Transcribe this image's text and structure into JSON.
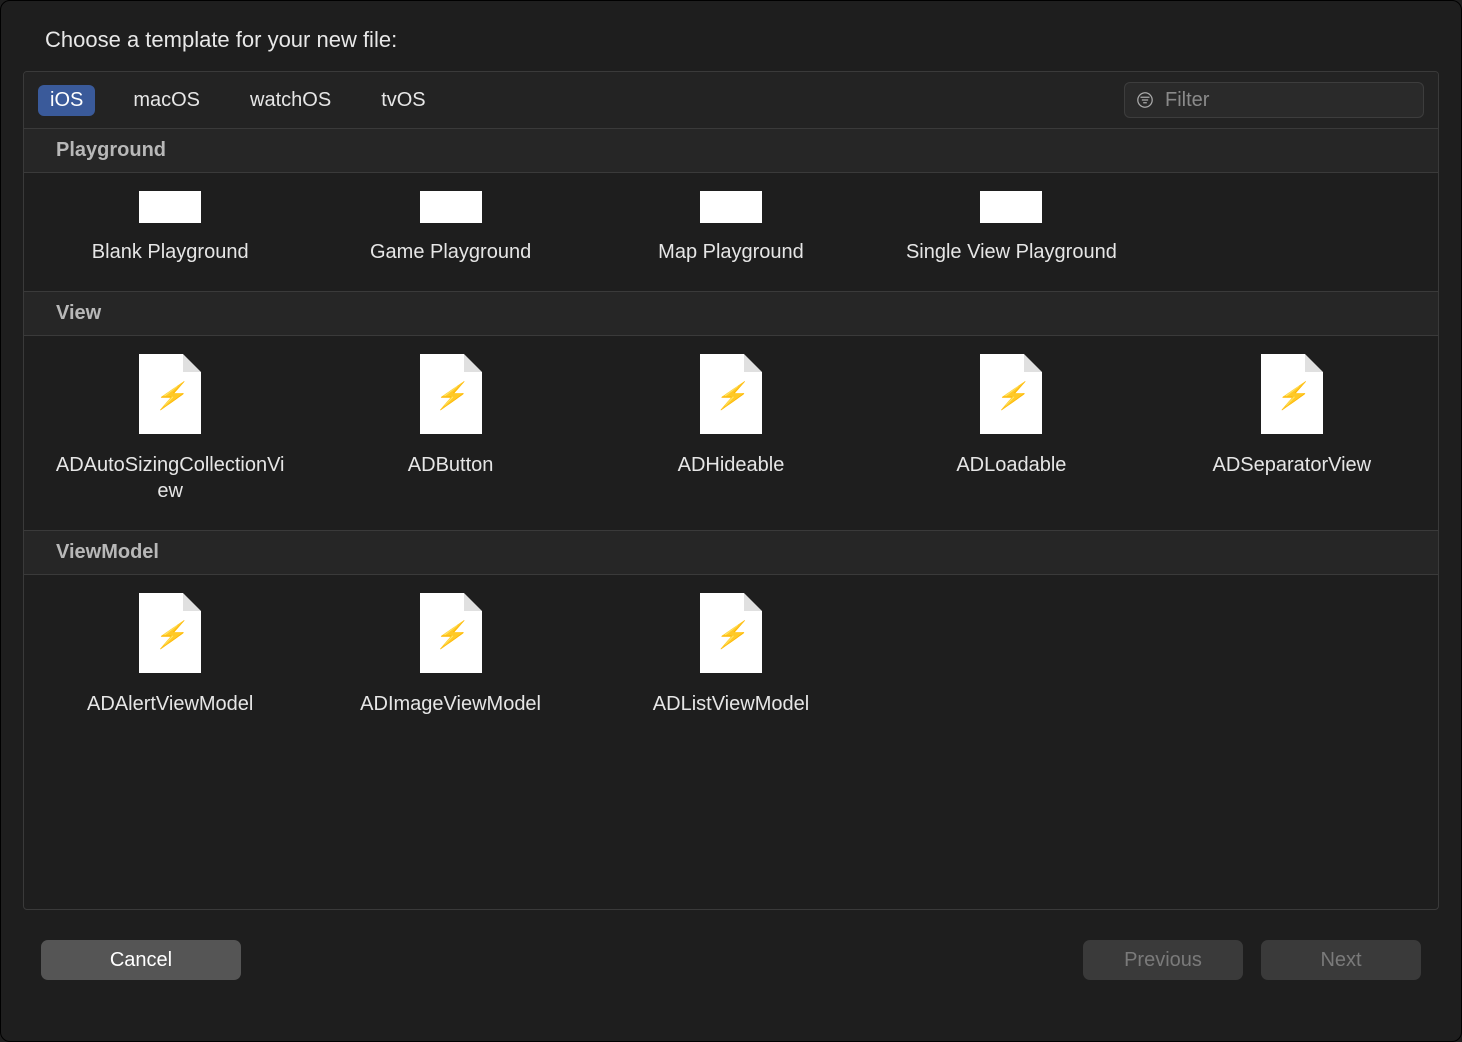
{
  "title": "Choose a template for your new file:",
  "tabs": {
    "items": [
      {
        "label": "iOS",
        "active": true
      },
      {
        "label": "macOS",
        "active": false
      },
      {
        "label": "watchOS",
        "active": false
      },
      {
        "label": "tvOS",
        "active": false
      }
    ]
  },
  "filter": {
    "placeholder": "Filter",
    "value": ""
  },
  "sections": [
    {
      "title": "Playground",
      "cut_icons": true,
      "items": [
        {
          "label": "Blank Playground"
        },
        {
          "label": "Game Playground"
        },
        {
          "label": "Map Playground"
        },
        {
          "label": "Single View Playground"
        }
      ]
    },
    {
      "title": "View",
      "cut_icons": false,
      "items": [
        {
          "label": "ADAutoSizingCollectionView"
        },
        {
          "label": "ADButton"
        },
        {
          "label": "ADHideable"
        },
        {
          "label": "ADLoadable"
        },
        {
          "label": "ADSeparatorView"
        }
      ]
    },
    {
      "title": "ViewModel",
      "cut_icons": false,
      "items": [
        {
          "label": "ADAlertViewModel"
        },
        {
          "label": "ADImageViewModel"
        },
        {
          "label": "ADListViewModel"
        }
      ]
    }
  ],
  "footer": {
    "cancel": "Cancel",
    "previous": "Previous",
    "next": "Next"
  }
}
